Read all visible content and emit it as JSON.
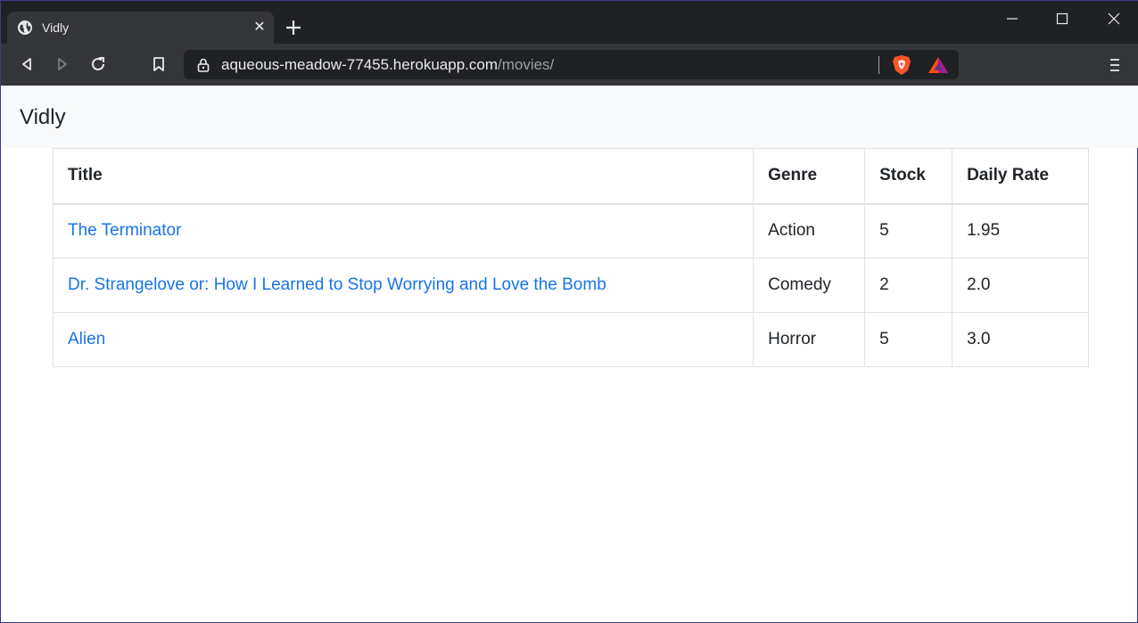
{
  "browser": {
    "tab": {
      "title": "Vidly",
      "close": "✕"
    },
    "url": {
      "host": "aqueous-meadow-77455.herokuapp.com",
      "path": "/movies/"
    }
  },
  "navbar": {
    "brand": "Vidly"
  },
  "table": {
    "headers": [
      "Title",
      "Genre",
      "Stock",
      "Daily Rate"
    ],
    "rows": [
      {
        "title": "The Terminator",
        "genre": "Action",
        "stock": "5",
        "rate": "1.95"
      },
      {
        "title": "Dr. Strangelove or: How I Learned to Stop Worrying and Love the Bomb",
        "genre": "Comedy",
        "stock": "2",
        "rate": "2.0"
      },
      {
        "title": "Alien",
        "genre": "Horror",
        "stock": "5",
        "rate": "3.0"
      }
    ]
  },
  "colors": {
    "link": "#1a73e8",
    "navbar_bg": "#f8f9fa",
    "chrome_dark": "#202124",
    "chrome_toolbar": "#35363a"
  }
}
